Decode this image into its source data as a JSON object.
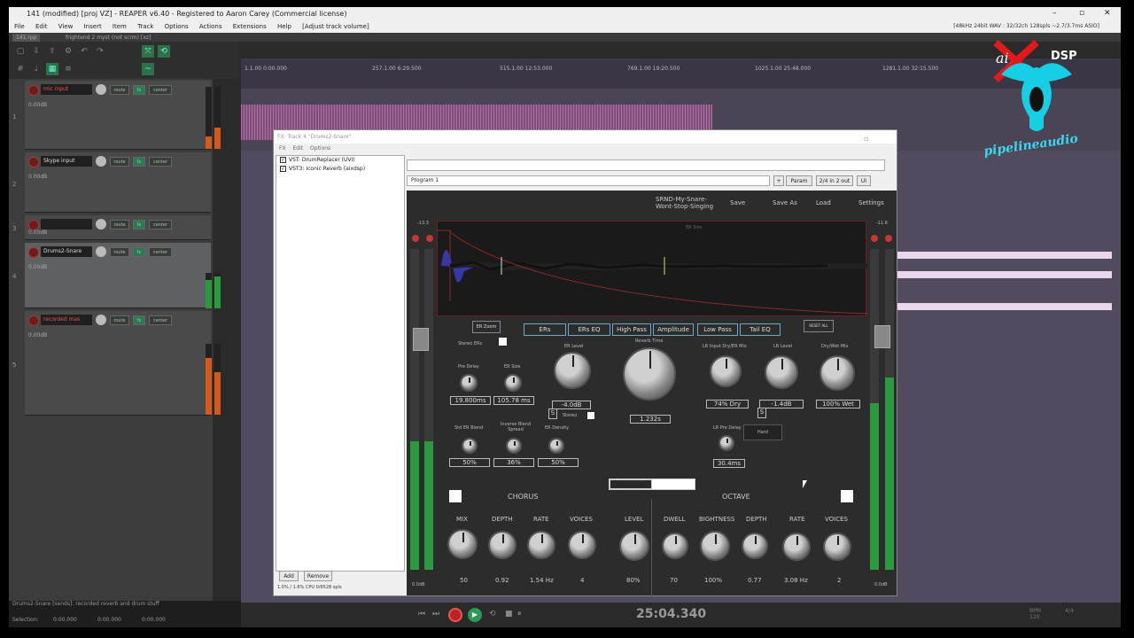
{
  "window": {
    "title": "141 (modified) [proj VZ] - REAPER v6.40 - Registered to Aaron Carey (Commercial license)",
    "controls": [
      "–",
      "▫",
      "✕"
    ]
  },
  "menu": {
    "items": [
      "File",
      "Edit",
      "View",
      "Insert",
      "Item",
      "Track",
      "Options",
      "Actions",
      "Extensions",
      "Help",
      "[Adjust track volume]"
    ],
    "status_right": "[48kHz 24bit WAV : 32/32ch 128spls ~2.7/3.7ms ASIO]"
  },
  "tabs": [
    "141.rpp",
    "frightend 2 myst (not scrm) [xz]"
  ],
  "tracks": [
    {
      "num": "1",
      "name": "mic input",
      "sub": "0.00dB",
      "fx": "route",
      "pan": "center"
    },
    {
      "num": "2",
      "name": "Skype input",
      "sub": "0.00dB",
      "fx": "route",
      "pan": "center"
    },
    {
      "num": "3",
      "name": "",
      "sub": "0.00dB",
      "fx": "route",
      "pan": "center"
    },
    {
      "num": "4",
      "name": "Drums2-Snare",
      "sub": "0.00dB",
      "fx": "route",
      "pan": "center"
    },
    {
      "num": "5",
      "name": "recorded mas",
      "sub": "0.00dB",
      "fx": "route",
      "pan": "center"
    }
  ],
  "ruler": [
    "1.1.00\n0:00.000",
    "257.1.00\n6:29.500",
    "515.1.00\n12:53.000",
    "769.1.00\n19:20.500",
    "1025.1.00\n25:48.000",
    "1281.1.00\n32:15.500"
  ],
  "transport": {
    "time": "25:04.340",
    "rate": "BPM\n120",
    "sig": "4/4"
  },
  "status": {
    "track_info": "Drums2-Snare [sends]: recorded reverb and drum stuff",
    "selection": "Selection:",
    "sel_start": "0:00.000",
    "sel_end": "0:00.000",
    "sel_len": "0:00.000"
  },
  "fxwindow": {
    "title": "FX: Track 4 \"Drums2-Snare\"",
    "menu": [
      "FX",
      "Edit",
      "Options"
    ],
    "chain": [
      "VST: DrumReplacer (UVI)",
      "VST3: Iconic Reverb (aixdsp)"
    ],
    "add": "Add",
    "remove": "Remove",
    "cpu": "1.0% / 1.6% CPU 0/6528 spls",
    "preset": "Program 1",
    "buttons": [
      "+",
      "Param",
      "2/4 in 2 out",
      "UI"
    ]
  },
  "plugin": {
    "preset_name": "SRND-My-Snare-\nWont-Stop-Singing",
    "header": [
      "Save",
      "Save As",
      "Load",
      "Settings"
    ],
    "meter_left": "-13.3",
    "meter_right": "-11.6",
    "display_title": "ER Size",
    "er_zoom": "ER Zoom",
    "reset": "RESET ALL",
    "tabs": [
      "ERs",
      "ERs EQ",
      "High Pass",
      "Amplitude",
      "Low Pass",
      "Tail EQ"
    ],
    "stereo_ers": "Stereo ERs",
    "er": {
      "pre_delay": {
        "label": "Pre Delay",
        "value": "19.800ms"
      },
      "er_size": {
        "label": "ER Size",
        "value": "105.78 ms"
      },
      "er_level": {
        "label": "ER Level",
        "value": "-4.0dB"
      },
      "reverb_time": {
        "label": "Reverb Time",
        "value": "1.232s"
      },
      "input_dry": {
        "label": "LR Input Dry/ER Mix",
        "value": "74% Dry"
      },
      "lr_level": {
        "label": "LR Level",
        "value": "-1.4dB"
      },
      "dry_wet": {
        "label": "Dry/Wet Mix",
        "value": "100% Wet"
      },
      "std_blend": {
        "label": "Std ER Blend",
        "value": "50%"
      },
      "inverse_blend": {
        "label": "Inverse Blend Spread",
        "value": "36%"
      },
      "er_density": {
        "label": "ER Density",
        "value": "50%"
      },
      "lr_predelay": {
        "label": "LR Pre Delay",
        "value": "30.4ms"
      },
      "mode": "Hard",
      "s_label": "S",
      "stereo": "Stereo"
    },
    "chorus": {
      "title": "CHORUS",
      "labels": [
        "MIX",
        "DEPTH",
        "RATE",
        "VOICES"
      ],
      "values": [
        "50",
        "0.92",
        "1.54 Hz",
        "4"
      ]
    },
    "octave": {
      "title": "OCTAVE",
      "labels": [
        "LEVEL",
        "DWELL",
        "BIGHTNESS",
        "DEPTH",
        "RATE",
        "VOICES"
      ],
      "values": [
        "80%",
        "70",
        "100%",
        "0.77",
        "3.08 Hz",
        "2"
      ]
    },
    "out_left": "0.0dB",
    "out_right": "0.0dB"
  },
  "logo": {
    "ai": "ai",
    "dsp": "DSP",
    "brand": "pipelineaudio"
  }
}
